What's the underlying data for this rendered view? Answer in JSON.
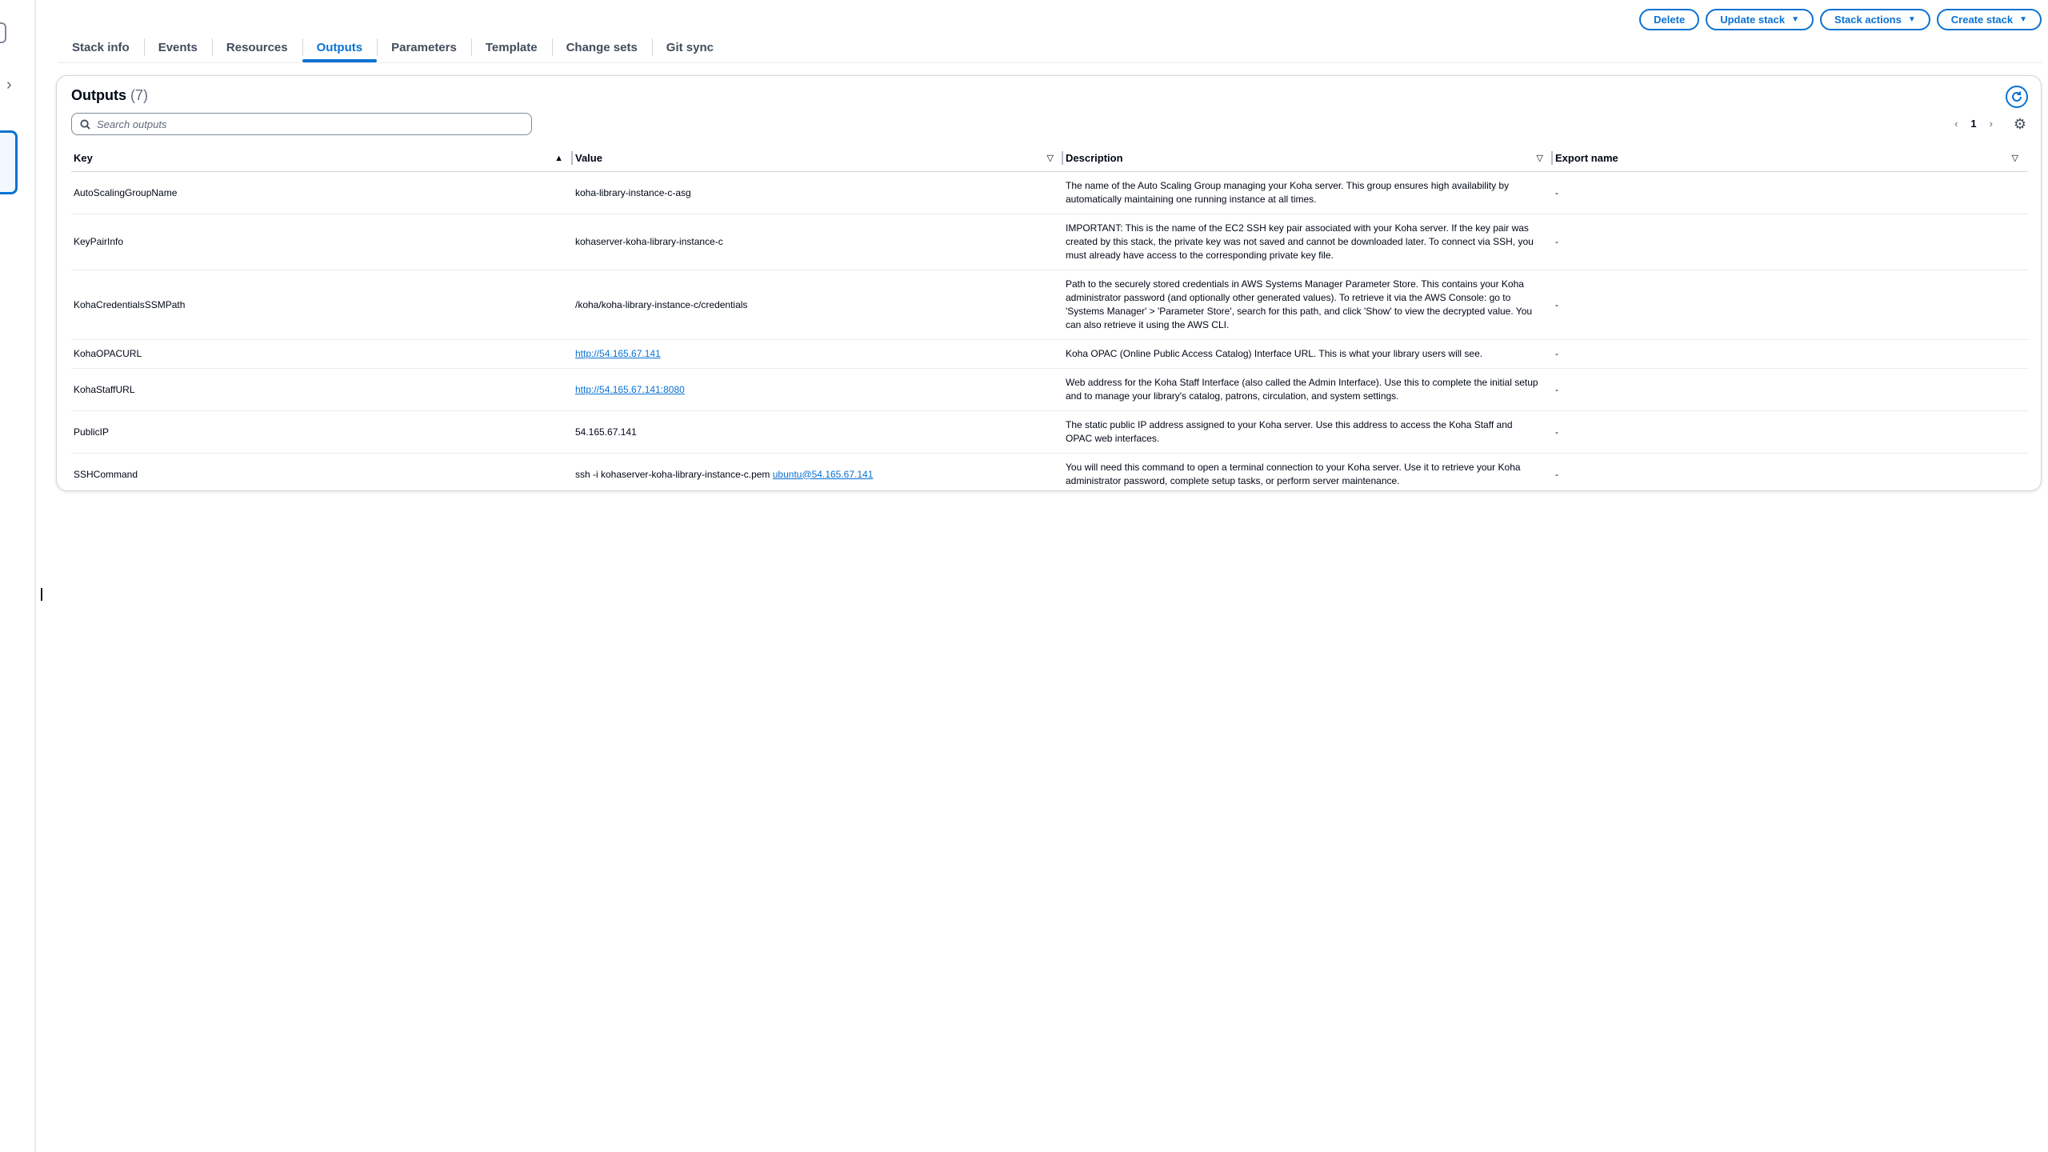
{
  "actions": {
    "delete": "Delete",
    "update_stack": "Update stack",
    "stack_actions": "Stack actions",
    "create_stack": "Create stack"
  },
  "tabs": [
    {
      "label": "Stack info"
    },
    {
      "label": "Events"
    },
    {
      "label": "Resources"
    },
    {
      "label": "Outputs",
      "active": true
    },
    {
      "label": "Parameters"
    },
    {
      "label": "Template"
    },
    {
      "label": "Change sets"
    },
    {
      "label": "Git sync"
    }
  ],
  "outputs": {
    "title": "Outputs",
    "count": "(7)",
    "search_placeholder": "Search outputs",
    "page": "1",
    "columns": [
      "Key",
      "Value",
      "Description",
      "Export name"
    ],
    "rows": [
      {
        "key": "AutoScalingGroupName",
        "value": "koha-library-instance-c-asg",
        "description": "The name of the Auto Scaling Group managing your Koha server. This group ensures high availability by automatically maintaining one running instance at all times.",
        "export": "-"
      },
      {
        "key": "KeyPairInfo",
        "value": "kohaserver-koha-library-instance-c",
        "description": "IMPORTANT: This is the name of the EC2 SSH key pair associated with your Koha server. If the key pair was created by this stack, the private key was not saved and cannot be downloaded later. To connect via SSH, you must already have access to the corresponding private key file.",
        "export": "-"
      },
      {
        "key": "KohaCredentialsSSMPath",
        "value": "/koha/koha-library-instance-c/credentials",
        "description": "Path to the securely stored credentials in AWS Systems Manager Parameter Store. This contains your Koha administrator password (and optionally other generated values). To retrieve it via the AWS Console: go to 'Systems Manager' > 'Parameter Store', search for this path, and click 'Show' to view the decrypted value. You can also retrieve it using the AWS CLI.",
        "export": "-"
      },
      {
        "key": "KohaOPACURL",
        "value_link": "http://54.165.67.141",
        "description": "Koha OPAC (Online Public Access Catalog) Interface URL. This is what your library users will see.",
        "export": "-"
      },
      {
        "key": "KohaStaffURL",
        "value_link": "http://54.165.67.141:8080",
        "description": "Web address for the Koha Staff Interface (also called the Admin Interface). Use this to complete the initial setup and to manage your library's catalog, patrons, circulation, and system settings.",
        "export": "-"
      },
      {
        "key": "PublicIP",
        "value": "54.165.67.141",
        "description": "The static public IP address assigned to your Koha server. Use this address to access the Koha Staff and OPAC web interfaces.",
        "export": "-"
      },
      {
        "key": "SSHCommand",
        "value": "ssh -i kohaserver-koha-library-instance-c.pem ",
        "value_link": "ubuntu@54.165.67.141",
        "description": "You will need this command to open a terminal connection to your Koha server. Use it to retrieve your Koha administrator password, complete setup tasks, or perform server maintenance.",
        "export": "-"
      }
    ]
  },
  "icons": {
    "refresh": "refresh-icon",
    "search": "search-icon",
    "settings": "gear-icon",
    "prev": "chevron-left-icon",
    "next": "chevron-right-icon"
  },
  "colors": {
    "accent": "#0972d3",
    "text": "#000716",
    "muted": "#5f6b7a"
  }
}
